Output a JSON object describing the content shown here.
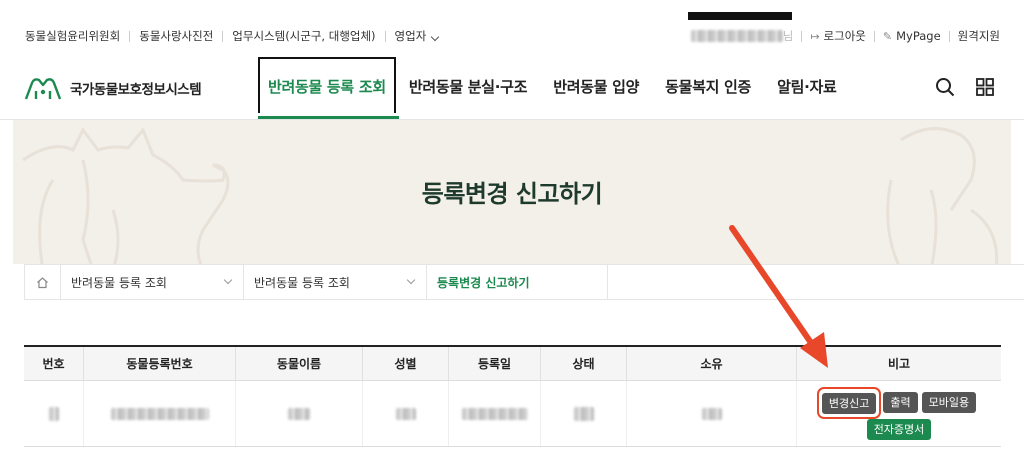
{
  "topbar": {
    "left_links": [
      "동물실험윤리위원회",
      "동물사랑사진전",
      "업무시스템(시군구, 대행업체)",
      "영업자"
    ],
    "user_suffix": "님",
    "logout": "로그아웃",
    "mypage": "MyPage",
    "remote": "원격지원"
  },
  "nav": {
    "logo_text": "국가동물보호정보시스템",
    "menu": [
      "반려동물 등록 조회",
      "반려동물 분실·구조",
      "반려동물 입양",
      "동물복지 인증",
      "알림·자료"
    ]
  },
  "hero": {
    "title": "등록변경 신고하기"
  },
  "breadcrumb": {
    "items": [
      "반려동물 등록 조회",
      "반려동물 등록 조회",
      "등록변경 신고하기"
    ]
  },
  "table": {
    "headers": [
      "번호",
      "동물등록번호",
      "동물이름",
      "성별",
      "등록일",
      "상태",
      "소유",
      "비고"
    ],
    "row_actions": {
      "change_report": "변경신고",
      "print": "출력",
      "mobile": "모바일용",
      "e_certificate": "전자증명서"
    }
  },
  "colors": {
    "accent": "#1c8a4f",
    "highlight": "#e8472a"
  }
}
